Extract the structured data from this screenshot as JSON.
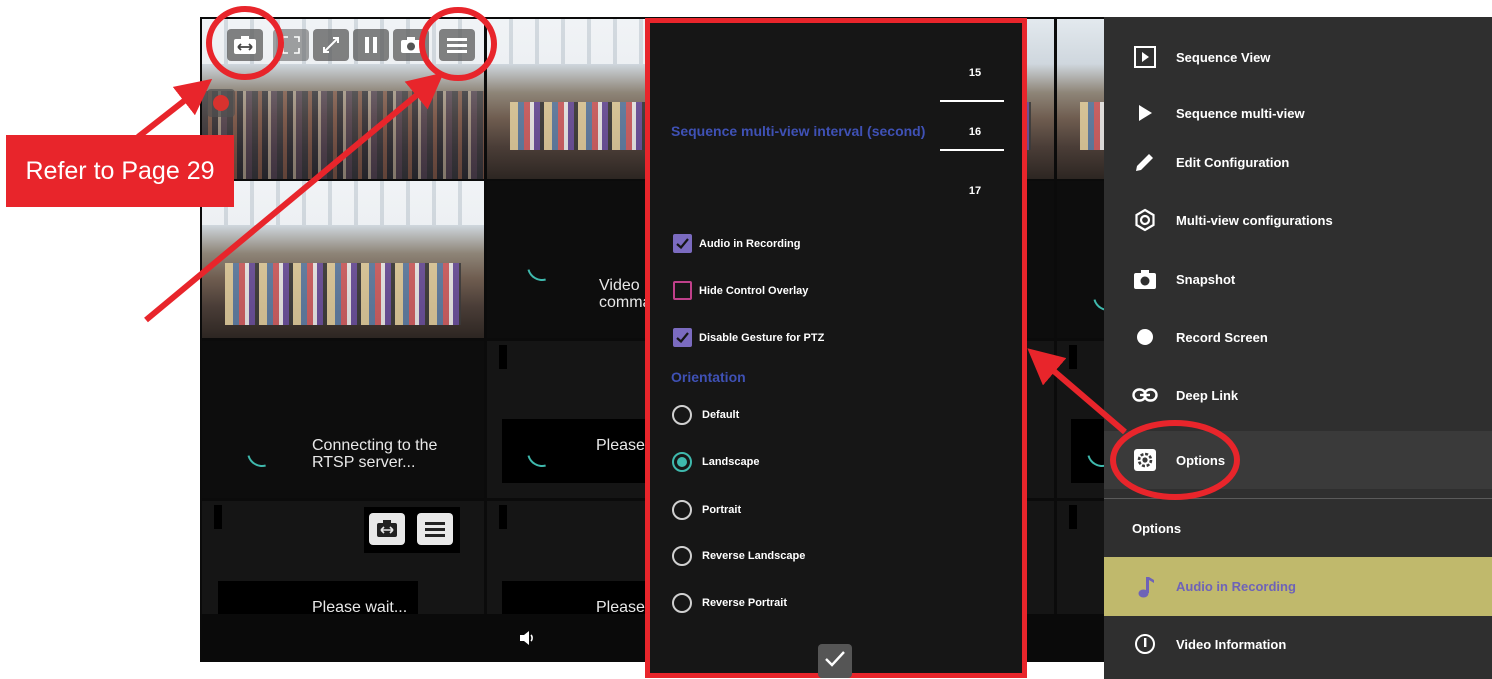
{
  "callout": {
    "text": "Refer to Page 29"
  },
  "grid": {
    "tiles": {
      "t5_line1": "Video p",
      "t5_line2": "comma",
      "t9_line1": "Connecting to the",
      "t9_line2": "RTSP server...",
      "t10_text": "Please",
      "t13_text": "Please wait...",
      "t14_text": "Please"
    }
  },
  "dialog": {
    "interval_label": "Sequence multi-view interval (second)",
    "interval_options": [
      "15",
      "16",
      "17"
    ],
    "interval_selected": "16",
    "checkboxes": [
      {
        "label": "Audio in Recording",
        "checked": true
      },
      {
        "label": "Hide Control Overlay",
        "checked": false
      },
      {
        "label": "Disable Gesture for PTZ",
        "checked": true
      }
    ],
    "orientation_title": "Orientation",
    "orientations": [
      {
        "label": "Default",
        "selected": false
      },
      {
        "label": "Landscape",
        "selected": true
      },
      {
        "label": "Portrait",
        "selected": false
      },
      {
        "label": "Reverse Landscape",
        "selected": false
      },
      {
        "label": "Reverse Portrait",
        "selected": false
      }
    ],
    "confirm_icon": "check-icon"
  },
  "menu": {
    "items": [
      {
        "label": "Sequence View",
        "icon": "play-box-icon"
      },
      {
        "label": "Sequence multi-view",
        "icon": "play-icon"
      },
      {
        "label": "Edit Configuration",
        "icon": "pencil-icon"
      },
      {
        "label": "Multi-view configurations",
        "icon": "hexagon-gear-icon"
      },
      {
        "label": "Snapshot",
        "icon": "camera-icon"
      },
      {
        "label": "Record Screen",
        "icon": "record-dot-icon"
      },
      {
        "label": "Deep Link",
        "icon": "link-icon"
      },
      {
        "label": "Options",
        "icon": "gear-icon"
      }
    ],
    "section_title": "Options",
    "sub_items": [
      {
        "label": "Audio in Recording",
        "icon": "music-note-icon"
      },
      {
        "label": "Video Information",
        "icon": "info-icon"
      }
    ]
  },
  "colors": {
    "annotation_red": "#e8252b",
    "accent_blue": "#3f51b5",
    "accent_teal": "#3fb9ad",
    "checkbox_purple": "#7b6bc0",
    "highlight_olive": "#c0b96c"
  }
}
